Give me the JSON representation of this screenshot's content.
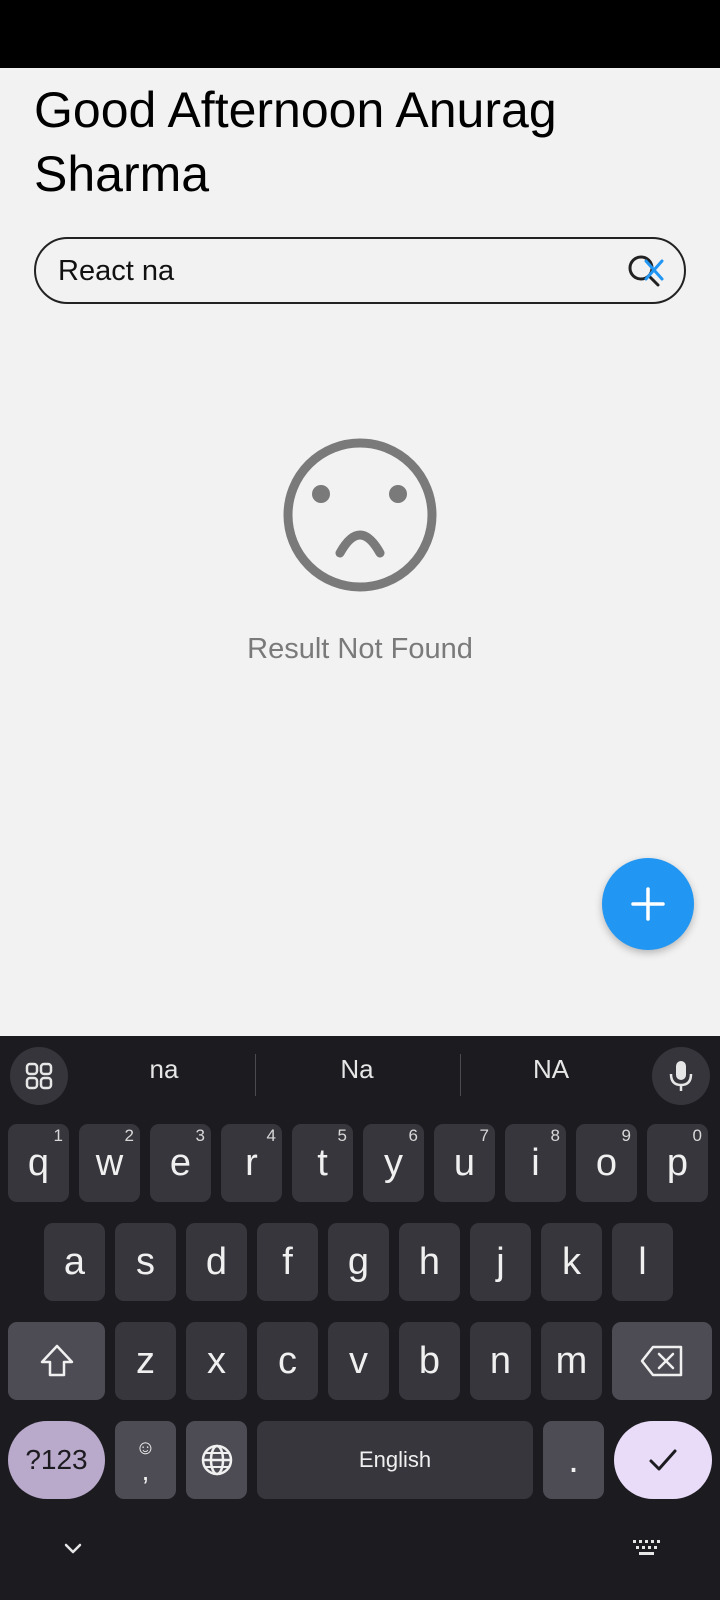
{
  "header": {
    "greeting": "Good Afternoon Anurag Sharma"
  },
  "search": {
    "value": "React na",
    "clear_icon": "clear-search-icon"
  },
  "empty_state": {
    "icon": "sad-face-icon",
    "message": "Result Not Found"
  },
  "fab": {
    "icon": "plus-icon",
    "color": "#2196f3"
  },
  "keyboard": {
    "suggestions": [
      "na",
      "Na",
      "NA"
    ],
    "row1": [
      {
        "k": "q",
        "h": "1"
      },
      {
        "k": "w",
        "h": "2"
      },
      {
        "k": "e",
        "h": "3"
      },
      {
        "k": "r",
        "h": "4"
      },
      {
        "k": "t",
        "h": "5"
      },
      {
        "k": "y",
        "h": "6"
      },
      {
        "k": "u",
        "h": "7"
      },
      {
        "k": "i",
        "h": "8"
      },
      {
        "k": "o",
        "h": "9"
      },
      {
        "k": "p",
        "h": "0"
      }
    ],
    "row2": [
      "a",
      "s",
      "d",
      "f",
      "g",
      "h",
      "j",
      "k",
      "l"
    ],
    "row3": [
      "z",
      "x",
      "c",
      "v",
      "b",
      "n",
      "m"
    ],
    "symbols_label": "?123",
    "comma_label": ",",
    "space_label": "English",
    "period_label": ".",
    "accent_color": "#b9a9cb"
  }
}
